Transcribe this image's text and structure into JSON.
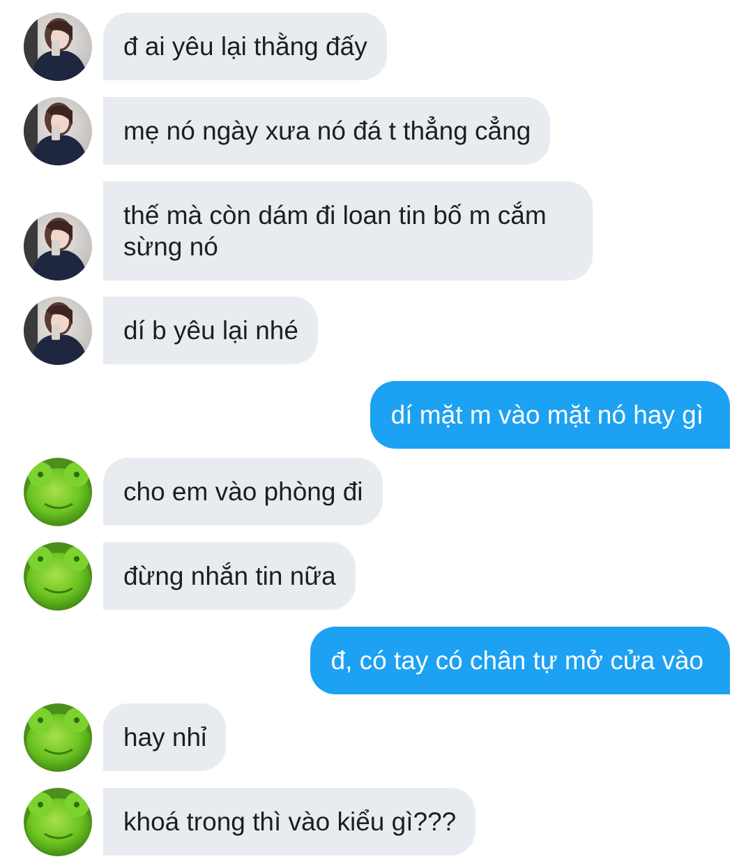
{
  "colors": {
    "incoming_bubble": "#e8ecf0",
    "outgoing_bubble": "#1da1f2",
    "incoming_text": "#1c1e21",
    "outgoing_text": "#ffffff"
  },
  "avatars": {
    "girl": "girl-photo-avatar",
    "frog": "frog-plush-avatar"
  },
  "messages": [
    {
      "sender": "girl",
      "direction": "in",
      "text": "đ ai yêu lại thằng đấy"
    },
    {
      "sender": "girl",
      "direction": "in",
      "text": "mẹ nó ngày xưa nó đá t thẳng cẳng"
    },
    {
      "sender": "girl",
      "direction": "in",
      "text": "thế mà còn dám đi loan tin bố m cắm sừng nó"
    },
    {
      "sender": "girl",
      "direction": "in",
      "text": "dí b yêu lại nhé"
    },
    {
      "sender": "me",
      "direction": "out",
      "text": "dí mặt m vào mặt nó hay gì"
    },
    {
      "sender": "frog",
      "direction": "in",
      "text": "cho em vào phòng đi"
    },
    {
      "sender": "frog",
      "direction": "in",
      "text": "đừng nhắn tin nữa"
    },
    {
      "sender": "me",
      "direction": "out",
      "text": "đ, có tay có chân tự mở cửa vào"
    },
    {
      "sender": "frog",
      "direction": "in",
      "text": "hay nhỉ"
    },
    {
      "sender": "frog",
      "direction": "in",
      "text": "khoá trong thì vào kiểu gì???"
    }
  ]
}
